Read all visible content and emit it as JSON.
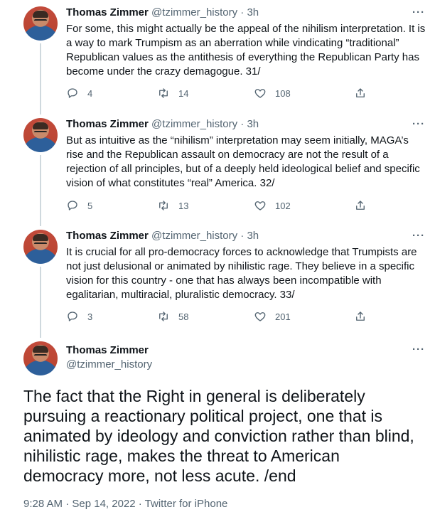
{
  "replies": [
    {
      "name": "Thomas Zimmer",
      "handle": "@tzimmer_history",
      "time": "· 3h",
      "text": "For some, this might actually be the appeal of the nihilism interpretation. It is a way to mark Trumpism as an aberration while vindicating “traditional” Republican values as the antithesis of everything the Republican Party has become under the crazy demagogue. 31/",
      "replies": "4",
      "retweets": "14",
      "likes": "108"
    },
    {
      "name": "Thomas Zimmer",
      "handle": "@tzimmer_history",
      "time": "· 3h",
      "text": "But as intuitive as the “nihilism” interpretation may seem initially, MAGA’s rise and the Republican assault on democracy are not the result of a rejection of all principles, but of a deeply held ideological belief and specific vision of what constitutes “real” America. 32/",
      "replies": "5",
      "retweets": "13",
      "likes": "102"
    },
    {
      "name": "Thomas Zimmer",
      "handle": "@tzimmer_history",
      "time": "· 3h",
      "text": "It is crucial for all pro-democracy forces to acknowledge that Trumpists are not just delusional or animated by nihilistic rage. They believe in a specific vision for this country - one that has always been incompatible with egalitarian, multiracial, pluralistic democracy. 33/",
      "replies": "3",
      "retweets": "58",
      "likes": "201"
    }
  ],
  "main": {
    "name": "Thomas Zimmer",
    "handle": "@tzimmer_history",
    "text": "The fact that the Right in general is deliberately pursuing a reactionary political project, one that is animated by ideology and conviction rather than blind, nihilistic rage, makes the threat to American democracy more, not less acute. /end",
    "timestamp": "9:28 AM · Sep 14, 2022 · ",
    "source": "Twitter for iPhone"
  },
  "more_label": "···"
}
